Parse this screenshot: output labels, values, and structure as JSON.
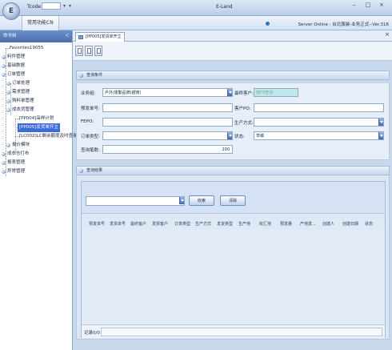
{
  "titlebar": {
    "tcode_label": "Tcode",
    "app_title": "E-Land",
    "minimize": "–",
    "maximize": "□",
    "close": "×"
  },
  "menubar": {
    "active_menu": "常用功能CN",
    "server_status": "Server Online : 台北服装-业务正式--Ver.316"
  },
  "nav": {
    "header": "命令树",
    "pin": "ᐸ",
    "items": [
      {
        "label": "Favorites19055"
      },
      {
        "label": "料件管理"
      },
      {
        "label": "基础数据"
      },
      {
        "label": "订单管理"
      },
      {
        "label": "订单处理"
      },
      {
        "label": "需求管理"
      },
      {
        "label": "购料单管理"
      },
      {
        "label": "成衣货管理"
      },
      {
        "label": "[PP004]采样计划"
      },
      {
        "label": "[PP005]发货单开立"
      },
      {
        "label": "[LC002]LC剩余额度及时查询"
      },
      {
        "label": "报价模块"
      },
      {
        "label": "成衣仓打布"
      },
      {
        "label": "报表管理"
      },
      {
        "label": "异常管理"
      }
    ]
  },
  "tab": {
    "label": "[PP005]发货单开立",
    "close": "×"
  },
  "query_section": {
    "title": "查询条件",
    "fields": {
      "business_group_label": "业务组:",
      "business_group_value": "戶外/運動品牌(越南)",
      "final_customer_label": "最终客户:",
      "final_customer_placeholder": "按F9查询",
      "pre_ship_no_label": "预发单号:",
      "customer_po_label": "客户PO:",
      "fepo_label": "FEPO:",
      "production_method_label": "生产方式:",
      "order_type_label": "订单类型:",
      "status_label": "状态:",
      "status_value": "草稿",
      "query_count_label": "查询笔数:",
      "query_count_value": "200"
    }
  },
  "result_section": {
    "title": "查询结果",
    "query_button": "收索",
    "clear_button": "清除",
    "columns": [
      "预发单号",
      "发货单号",
      "最终客户",
      "发票客户",
      "订单类型",
      "生产方式",
      "发货类型",
      "生产地",
      "收汇地",
      "预发量",
      "产地发...",
      "创建人",
      "创建日期",
      "状态"
    ],
    "pager_label": "记录0/0"
  }
}
